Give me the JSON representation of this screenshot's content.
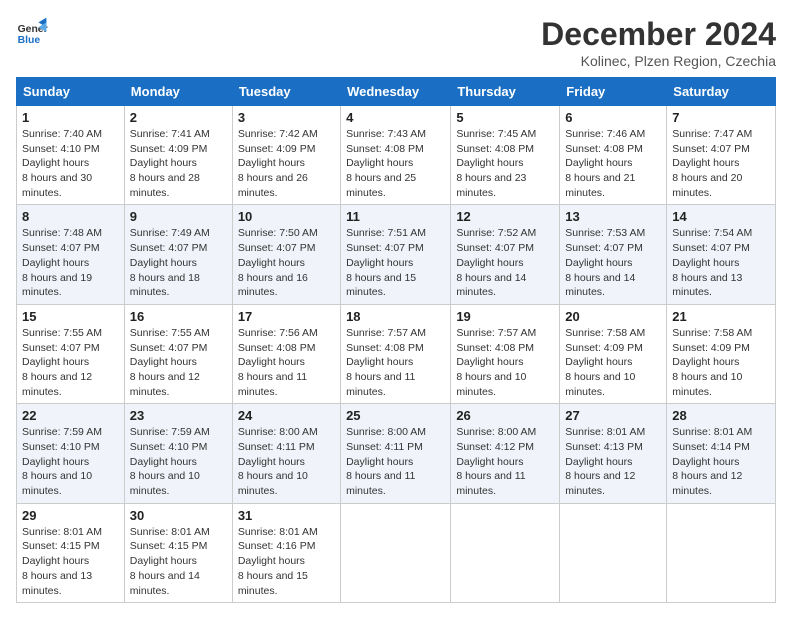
{
  "logo": {
    "line1": "General",
    "line2": "Blue"
  },
  "title": "December 2024",
  "subtitle": "Kolinec, Plzen Region, Czechia",
  "weekdays": [
    "Sunday",
    "Monday",
    "Tuesday",
    "Wednesday",
    "Thursday",
    "Friday",
    "Saturday"
  ],
  "weeks": [
    [
      {
        "day": "1",
        "sunrise": "7:40 AM",
        "sunset": "4:10 PM",
        "daylight": "8 hours and 30 minutes."
      },
      {
        "day": "2",
        "sunrise": "7:41 AM",
        "sunset": "4:09 PM",
        "daylight": "8 hours and 28 minutes."
      },
      {
        "day": "3",
        "sunrise": "7:42 AM",
        "sunset": "4:09 PM",
        "daylight": "8 hours and 26 minutes."
      },
      {
        "day": "4",
        "sunrise": "7:43 AM",
        "sunset": "4:08 PM",
        "daylight": "8 hours and 25 minutes."
      },
      {
        "day": "5",
        "sunrise": "7:45 AM",
        "sunset": "4:08 PM",
        "daylight": "8 hours and 23 minutes."
      },
      {
        "day": "6",
        "sunrise": "7:46 AM",
        "sunset": "4:08 PM",
        "daylight": "8 hours and 21 minutes."
      },
      {
        "day": "7",
        "sunrise": "7:47 AM",
        "sunset": "4:07 PM",
        "daylight": "8 hours and 20 minutes."
      }
    ],
    [
      {
        "day": "8",
        "sunrise": "7:48 AM",
        "sunset": "4:07 PM",
        "daylight": "8 hours and 19 minutes."
      },
      {
        "day": "9",
        "sunrise": "7:49 AM",
        "sunset": "4:07 PM",
        "daylight": "8 hours and 18 minutes."
      },
      {
        "day": "10",
        "sunrise": "7:50 AM",
        "sunset": "4:07 PM",
        "daylight": "8 hours and 16 minutes."
      },
      {
        "day": "11",
        "sunrise": "7:51 AM",
        "sunset": "4:07 PM",
        "daylight": "8 hours and 15 minutes."
      },
      {
        "day": "12",
        "sunrise": "7:52 AM",
        "sunset": "4:07 PM",
        "daylight": "8 hours and 14 minutes."
      },
      {
        "day": "13",
        "sunrise": "7:53 AM",
        "sunset": "4:07 PM",
        "daylight": "8 hours and 14 minutes."
      },
      {
        "day": "14",
        "sunrise": "7:54 AM",
        "sunset": "4:07 PM",
        "daylight": "8 hours and 13 minutes."
      }
    ],
    [
      {
        "day": "15",
        "sunrise": "7:55 AM",
        "sunset": "4:07 PM",
        "daylight": "8 hours and 12 minutes."
      },
      {
        "day": "16",
        "sunrise": "7:55 AM",
        "sunset": "4:07 PM",
        "daylight": "8 hours and 12 minutes."
      },
      {
        "day": "17",
        "sunrise": "7:56 AM",
        "sunset": "4:08 PM",
        "daylight": "8 hours and 11 minutes."
      },
      {
        "day": "18",
        "sunrise": "7:57 AM",
        "sunset": "4:08 PM",
        "daylight": "8 hours and 11 minutes."
      },
      {
        "day": "19",
        "sunrise": "7:57 AM",
        "sunset": "4:08 PM",
        "daylight": "8 hours and 10 minutes."
      },
      {
        "day": "20",
        "sunrise": "7:58 AM",
        "sunset": "4:09 PM",
        "daylight": "8 hours and 10 minutes."
      },
      {
        "day": "21",
        "sunrise": "7:58 AM",
        "sunset": "4:09 PM",
        "daylight": "8 hours and 10 minutes."
      }
    ],
    [
      {
        "day": "22",
        "sunrise": "7:59 AM",
        "sunset": "4:10 PM",
        "daylight": "8 hours and 10 minutes."
      },
      {
        "day": "23",
        "sunrise": "7:59 AM",
        "sunset": "4:10 PM",
        "daylight": "8 hours and 10 minutes."
      },
      {
        "day": "24",
        "sunrise": "8:00 AM",
        "sunset": "4:11 PM",
        "daylight": "8 hours and 10 minutes."
      },
      {
        "day": "25",
        "sunrise": "8:00 AM",
        "sunset": "4:11 PM",
        "daylight": "8 hours and 11 minutes."
      },
      {
        "day": "26",
        "sunrise": "8:00 AM",
        "sunset": "4:12 PM",
        "daylight": "8 hours and 11 minutes."
      },
      {
        "day": "27",
        "sunrise": "8:01 AM",
        "sunset": "4:13 PM",
        "daylight": "8 hours and 12 minutes."
      },
      {
        "day": "28",
        "sunrise": "8:01 AM",
        "sunset": "4:14 PM",
        "daylight": "8 hours and 12 minutes."
      }
    ],
    [
      {
        "day": "29",
        "sunrise": "8:01 AM",
        "sunset": "4:15 PM",
        "daylight": "8 hours and 13 minutes."
      },
      {
        "day": "30",
        "sunrise": "8:01 AM",
        "sunset": "4:15 PM",
        "daylight": "8 hours and 14 minutes."
      },
      {
        "day": "31",
        "sunrise": "8:01 AM",
        "sunset": "4:16 PM",
        "daylight": "8 hours and 15 minutes."
      },
      null,
      null,
      null,
      null
    ]
  ],
  "labels": {
    "sunrise": "Sunrise:",
    "sunset": "Sunset:",
    "daylight": "Daylight hours"
  }
}
